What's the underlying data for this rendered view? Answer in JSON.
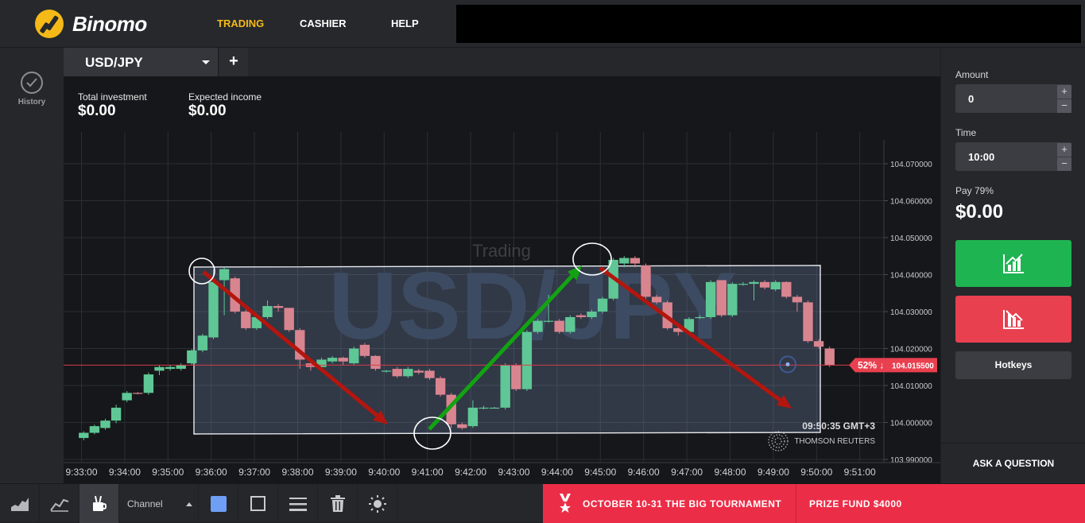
{
  "header": {
    "logo_text": "Binomo",
    "nav": [
      {
        "label": "TRADING",
        "active": true
      },
      {
        "label": "CASHIER",
        "active": false
      },
      {
        "label": "HELP",
        "active": false
      }
    ]
  },
  "sidebar": {
    "history_label": "History"
  },
  "tab": {
    "asset": "USD/JPY",
    "add_label": "+"
  },
  "investment": {
    "total_label": "Total investment",
    "total_value": "$0.00",
    "expected_label": "Expected income",
    "expected_value": "$0.00"
  },
  "chart": {
    "watermark_mode": "Trading",
    "watermark_asset": "USD/JPY",
    "time_label": "09:50:35 GMT+3",
    "provider": "THOMSON REUTERS",
    "current_price": "104.015500",
    "current_badge": "52% ↓",
    "colors": {
      "up": "#5fc795",
      "down": "#d98590",
      "price_line": "#d23e4a",
      "arrow_down": "#b3160e",
      "arrow_up": "#12a312"
    }
  },
  "chart_data": {
    "type": "candlestick",
    "y_ticks": [
      "104.070000",
      "104.060000",
      "104.050000",
      "104.040000",
      "104.030000",
      "104.020000",
      "104.010000",
      "104.000000",
      "103.990000"
    ],
    "y_tick_values": [
      104.07,
      104.06,
      104.05,
      104.04,
      104.03,
      104.02,
      104.01,
      104.0,
      103.99
    ],
    "x_ticks": [
      "9:33:00",
      "9:34:00",
      "9:35:00",
      "9:36:00",
      "9:37:00",
      "9:38:00",
      "9:39:00",
      "9:40:00",
      "9:41:00",
      "9:42:00",
      "9:43:00",
      "9:44:00",
      "9:45:00",
      "9:46:00",
      "9:47:00",
      "9:48:00",
      "9:49:00",
      "9:50:00",
      "9:51:00"
    ],
    "current_price": 104.0155,
    "candles_start_minute": 33.0,
    "candles": [
      [
        103.9958,
        103.9972,
        103.9952,
        103.9976
      ],
      [
        103.9972,
        103.999,
        103.9968,
        103.9994
      ],
      [
        103.9985,
        104.0005,
        103.998,
        104.001
      ],
      [
        104.0005,
        104.004,
        103.9998,
        104.0048
      ],
      [
        104.006,
        104.008,
        104.0055,
        104.0085
      ],
      [
        104.008,
        104.0078,
        104.0076,
        104.0082
      ],
      [
        104.008,
        104.013,
        104.0075,
        104.0135
      ],
      [
        104.014,
        104.015,
        104.0128,
        104.0155
      ],
      [
        104.0145,
        104.015,
        104.014,
        104.0155
      ],
      [
        104.0145,
        104.0155,
        104.014,
        104.016
      ],
      [
        104.016,
        104.0195,
        104.0155,
        104.0198
      ],
      [
        104.0195,
        104.0235,
        104.019,
        104.024
      ],
      [
        104.023,
        104.038,
        104.0225,
        104.0415
      ],
      [
        104.0385,
        104.0415,
        104.029,
        104.042
      ],
      [
        104.039,
        104.03,
        104.0295,
        104.0395
      ],
      [
        104.03,
        104.0255,
        104.025,
        104.0305
      ],
      [
        104.0255,
        104.0285,
        104.025,
        104.0295
      ],
      [
        104.0285,
        104.0315,
        104.028,
        104.033
      ],
      [
        104.0315,
        104.031,
        104.03,
        104.032
      ],
      [
        104.031,
        104.025,
        104.0245,
        104.031
      ],
      [
        104.025,
        104.017,
        104.0145,
        104.0255
      ],
      [
        104.016,
        104.015,
        104.014,
        104.0165
      ],
      [
        104.015,
        104.017,
        104.0145,
        104.0175
      ],
      [
        104.0165,
        104.0175,
        104.016,
        104.018
      ],
      [
        104.0175,
        104.0165,
        104.0155,
        104.0178
      ],
      [
        104.016,
        104.02,
        104.0155,
        104.0205
      ],
      [
        104.021,
        104.018,
        104.0175,
        104.0215
      ],
      [
        104.018,
        104.0145,
        104.014,
        104.0182
      ],
      [
        104.014,
        104.014,
        104.0135,
        104.0142
      ],
      [
        104.0145,
        104.0125,
        104.012,
        104.015
      ],
      [
        104.0125,
        104.0145,
        104.012,
        104.015
      ],
      [
        104.014,
        104.0135,
        104.013,
        104.0145
      ],
      [
        104.014,
        104.012,
        104.0115,
        104.0145
      ],
      [
        104.012,
        104.0075,
        104.007,
        104.0125
      ],
      [
        104.0075,
        103.9995,
        103.9985,
        104.008
      ],
      [
        103.9995,
        103.9985,
        103.998,
        104.0
      ],
      [
        103.999,
        104.004,
        103.9985,
        104.006
      ],
      [
        104.004,
        104.004,
        104.0035,
        104.0045
      ],
      [
        104.004,
        104.004,
        104.0038,
        104.0042
      ],
      [
        104.004,
        104.0155,
        104.0035,
        104.016
      ],
      [
        104.0155,
        104.009,
        104.0085,
        104.016
      ],
      [
        104.009,
        104.0245,
        104.0085,
        104.025
      ],
      [
        104.0245,
        104.0275,
        104.024,
        104.028
      ],
      [
        104.0275,
        104.0275,
        104.027,
        104.0345
      ],
      [
        104.0275,
        104.0245,
        104.024,
        104.028
      ],
      [
        104.0245,
        104.0285,
        104.024,
        104.029
      ],
      [
        104.029,
        104.0285,
        104.028,
        104.0295
      ],
      [
        104.0285,
        104.03,
        104.028,
        104.0305
      ],
      [
        104.03,
        104.0335,
        104.0295,
        104.034
      ],
      [
        104.0335,
        104.044,
        104.033,
        104.0445
      ],
      [
        104.043,
        104.0445,
        104.042,
        104.045
      ],
      [
        104.0445,
        104.043,
        104.042,
        104.045
      ],
      [
        104.0425,
        104.034,
        104.0335,
        104.043
      ],
      [
        104.034,
        104.0325,
        104.032,
        104.0345
      ],
      [
        104.0325,
        104.0255,
        104.025,
        104.033
      ],
      [
        104.0255,
        104.0245,
        104.0235,
        104.026
      ],
      [
        104.0245,
        104.028,
        104.024,
        104.0285
      ],
      [
        104.0285,
        104.0285,
        104.028,
        104.029
      ],
      [
        104.0285,
        104.038,
        104.028,
        104.0385
      ],
      [
        104.0385,
        104.029,
        104.0285,
        104.0385
      ],
      [
        104.029,
        104.0375,
        104.0285,
        104.038
      ],
      [
        104.0375,
        104.0375,
        104.037,
        104.038
      ],
      [
        104.0375,
        104.038,
        104.033,
        104.0385
      ],
      [
        104.038,
        104.0365,
        104.036,
        104.0385
      ],
      [
        104.036,
        104.038,
        104.0355,
        104.0385
      ],
      [
        104.038,
        104.034,
        104.0335,
        104.0382
      ],
      [
        104.034,
        104.0325,
        104.03,
        104.0345
      ],
      [
        104.0325,
        104.022,
        104.0215,
        104.033
      ],
      [
        104.022,
        104.0205,
        104.02,
        104.0225
      ],
      [
        104.02,
        104.0155,
        104.015,
        104.0205
      ]
    ]
  },
  "right_panel": {
    "amount_label": "Amount",
    "amount_value": "0",
    "time_label": "Time",
    "time_value": "10:00",
    "plus": "+",
    "minus": "−",
    "pay_label": "Pay 79%",
    "pay_value": "$0.00",
    "hotkeys_label": "Hotkeys",
    "ask_label": "ASK A QUESTION"
  },
  "bottombar": {
    "channel_label": "Channel",
    "promo_text": "OCTOBER 10-31 THE BIG TOURNAMENT",
    "prize_text": "PRIZE FUND $4000"
  }
}
